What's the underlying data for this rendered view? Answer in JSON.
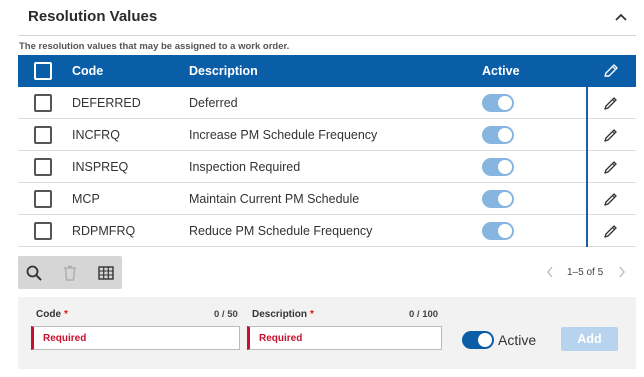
{
  "section": {
    "title": "Resolution Values",
    "description": "The resolution values that may be assigned to a work order."
  },
  "grid": {
    "columns": {
      "code": "Code",
      "description": "Description",
      "active": "Active"
    },
    "rows": [
      {
        "code": "DEFERRED",
        "description": "Deferred",
        "active": true
      },
      {
        "code": "INCFRQ",
        "description": "Increase PM Schedule Frequency",
        "active": true
      },
      {
        "code": "INSPREQ",
        "description": "Inspection Required",
        "active": true
      },
      {
        "code": "MCP",
        "description": "Maintain Current PM Schedule",
        "active": true
      },
      {
        "code": "RDPMFRQ",
        "description": "Reduce PM Schedule Frequency",
        "active": true
      }
    ]
  },
  "pager": {
    "info": "1–5 of 5"
  },
  "form": {
    "code": {
      "label": "Code",
      "required_mark": "*",
      "count": "0 / 50",
      "value": "Required"
    },
    "description": {
      "label": "Description",
      "required_mark": "*",
      "count": "0 / 100",
      "value": "Required"
    },
    "active_label": "Active",
    "add_label": "Add"
  },
  "colors": {
    "header_bg": "#0a5ea8",
    "toggle_on": "#86b5e0",
    "required_red": "#c8102e",
    "add_button_disabled": "#b8d3ee"
  }
}
